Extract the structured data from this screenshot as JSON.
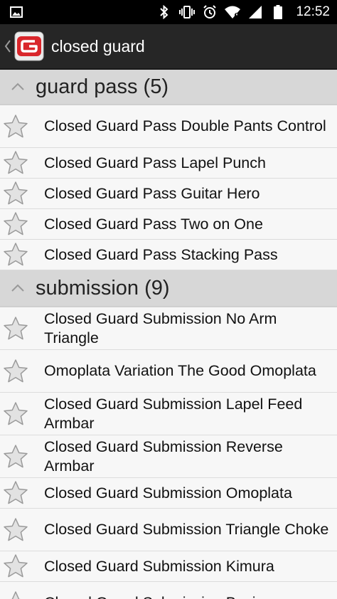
{
  "status_bar": {
    "time": "12:52",
    "icons": [
      "image-icon",
      "bluetooth-icon",
      "vibrate-icon",
      "alarm-icon",
      "wifi-icon",
      "signal-icon",
      "battery-icon"
    ]
  },
  "action_bar": {
    "title": "closed guard",
    "logo": "app-logo-icon"
  },
  "sections": [
    {
      "title": "guard pass (5)",
      "items": [
        "Closed Guard Pass Double Pants Control",
        "Closed Guard Pass Lapel Punch",
        "Closed Guard Pass Guitar Hero",
        "Closed Guard Pass Two on One",
        "Closed Guard Pass Stacking Pass"
      ]
    },
    {
      "title": "submission (9)",
      "items": [
        "Closed Guard Submission No Arm Triangle",
        "Omoplata Variation The Good Omoplata",
        "Closed Guard Submission Lapel Feed Armbar",
        "Closed Guard Submission Reverse Armbar",
        "Closed Guard Submission Omoplata",
        "Closed Guard Submission Triangle Choke",
        "Closed Guard Submission Kimura",
        "Closed Guard Submission Basic"
      ]
    }
  ],
  "colors": {
    "status_bar_bg": "#000000",
    "action_bar_bg": "#262626",
    "section_header_bg": "#d7d7d7",
    "list_bg": "#f7f7f7",
    "logo_red": "#d9262b"
  }
}
